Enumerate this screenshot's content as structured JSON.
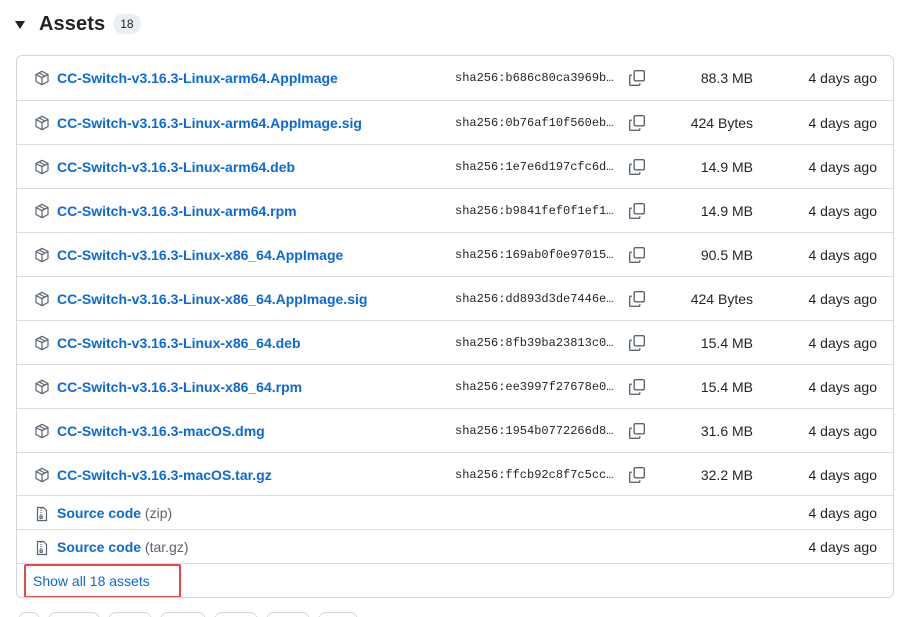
{
  "header": {
    "title": "Assets",
    "count": "18"
  },
  "assets": [
    {
      "name": "CC-Switch-v3.16.3-Linux-arm64.AppImage",
      "sha": "sha256:b686c80ca3969b…",
      "size": "88.3 MB",
      "date": "4 days ago"
    },
    {
      "name": "CC-Switch-v3.16.3-Linux-arm64.AppImage.sig",
      "sha": "sha256:0b76af10f560eb…",
      "size": "424 Bytes",
      "date": "4 days ago"
    },
    {
      "name": "CC-Switch-v3.16.3-Linux-arm64.deb",
      "sha": "sha256:1e7e6d197cfc6d…",
      "size": "14.9 MB",
      "date": "4 days ago"
    },
    {
      "name": "CC-Switch-v3.16.3-Linux-arm64.rpm",
      "sha": "sha256:b9841fef0f1ef1…",
      "size": "14.9 MB",
      "date": "4 days ago"
    },
    {
      "name": "CC-Switch-v3.16.3-Linux-x86_64.AppImage",
      "sha": "sha256:169ab0f0e97015…",
      "size": "90.5 MB",
      "date": "4 days ago"
    },
    {
      "name": "CC-Switch-v3.16.3-Linux-x86_64.AppImage.sig",
      "sha": "sha256:dd893d3de7446e…",
      "size": "424 Bytes",
      "date": "4 days ago"
    },
    {
      "name": "CC-Switch-v3.16.3-Linux-x86_64.deb",
      "sha": "sha256:8fb39ba23813c0…",
      "size": "15.4 MB",
      "date": "4 days ago"
    },
    {
      "name": "CC-Switch-v3.16.3-Linux-x86_64.rpm",
      "sha": "sha256:ee3997f27678e0…",
      "size": "15.4 MB",
      "date": "4 days ago"
    },
    {
      "name": "CC-Switch-v3.16.3-macOS.dmg",
      "sha": "sha256:1954b0772266d8…",
      "size": "31.6 MB",
      "date": "4 days ago"
    },
    {
      "name": "CC-Switch-v3.16.3-macOS.tar.gz",
      "sha": "sha256:ffcb92c8f7c5cc…",
      "size": "32.2 MB",
      "date": "4 days ago"
    }
  ],
  "source_code": [
    {
      "label": "Source code",
      "format": "(zip)",
      "date": "4 days ago"
    },
    {
      "label": "Source code",
      "format": "(tar.gz)",
      "date": "4 days ago"
    }
  ],
  "footer": {
    "show_all_label": "Show all 18 assets"
  },
  "icons": {
    "caret": "triangle-down-icon",
    "asset": "package-icon",
    "source": "file-zip-icon",
    "copy": "copy-icon"
  },
  "colors": {
    "link": "#0969da",
    "border": "#d0d7de",
    "highlight": "#e5484d"
  }
}
